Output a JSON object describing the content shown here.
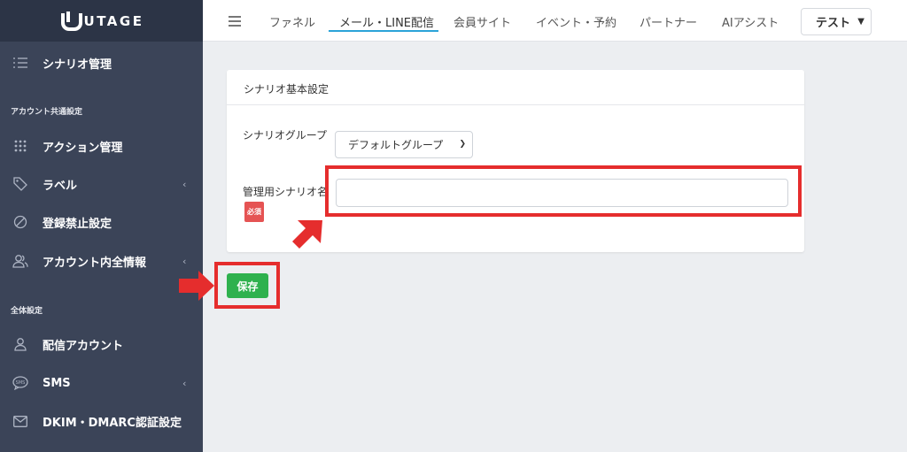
{
  "brand": {
    "name": "UTAGE"
  },
  "sidebar": {
    "items": [
      {
        "label": "シナリオ管理",
        "icon": "list-icon"
      },
      {
        "label": "アクション管理",
        "icon": "grid-icon"
      },
      {
        "label": "ラベル",
        "icon": "tag-icon"
      },
      {
        "label": "登録禁止設定",
        "icon": "ban-icon"
      },
      {
        "label": "アカウント内全情報",
        "icon": "users-icon"
      },
      {
        "label": "配信アカウント",
        "icon": "user-icon"
      },
      {
        "label": "SMS",
        "icon": "sms-icon"
      },
      {
        "label": "DKIM・DMARC認証設定",
        "icon": "mail-icon"
      }
    ],
    "sections": {
      "account_common": "アカウント共通設定",
      "global": "全体設定"
    }
  },
  "topbar": {
    "tabs": [
      "ファネル",
      "メール・LINE配信",
      "会員サイト",
      "イベント・予約",
      "パートナー",
      "AIアシスト"
    ],
    "active_tab": "メール・LINE配信",
    "user_select": "テスト"
  },
  "form": {
    "card_title": "シナリオ基本設定",
    "group_label": "シナリオグループ",
    "group_value": "デフォルトグループ",
    "name_label": "管理用シナリオ名",
    "required_badge": "必須",
    "name_value": ""
  },
  "actions": {
    "save_label": "保存"
  },
  "colors": {
    "sidebar": "#3b4458",
    "accent": "#2aa3d8",
    "save": "#2fb14e",
    "highlight": "#e52d2d"
  }
}
